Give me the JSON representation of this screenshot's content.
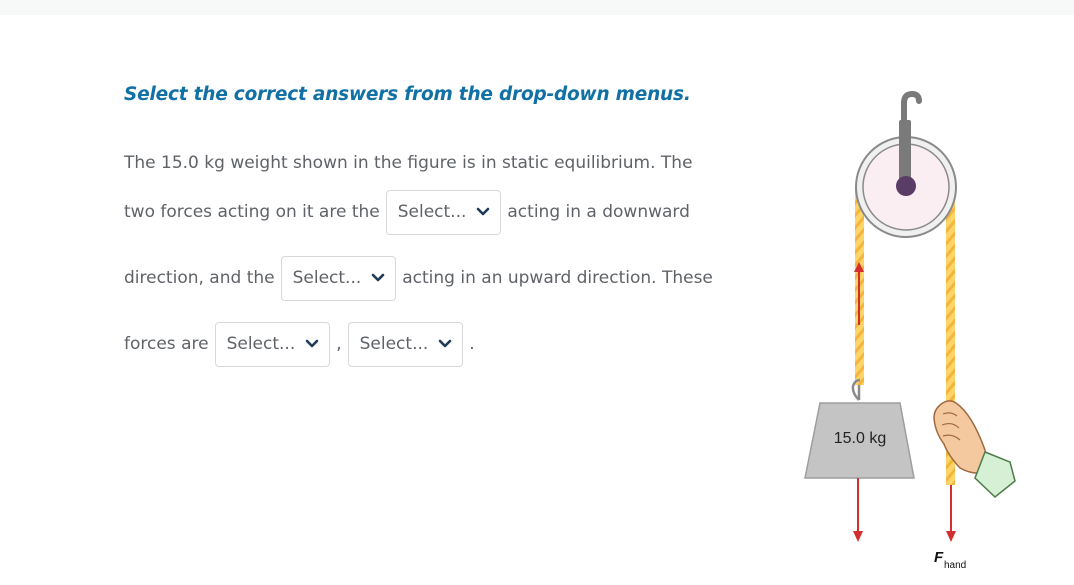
{
  "instruction": "Select the correct answers from the drop-down menus.",
  "question": {
    "line1": "The 15.0 kg weight shown in the figure is in static equilibrium. The",
    "line2_before": "two forces acting on it are the",
    "line2_after": "acting in a downward",
    "line3_before": "direction, and the",
    "line3_after": "acting in an upward direction. These",
    "line4_before": "forces are",
    "line4_sep": ",",
    "line4_end": "."
  },
  "dropdowns": [
    {
      "selected": "Select..."
    },
    {
      "selected": "Select..."
    },
    {
      "selected": "Select..."
    },
    {
      "selected": "Select..."
    }
  ],
  "figure": {
    "weight_label": "15.0 kg",
    "force_label_main": "F",
    "force_label_sub": "hand"
  },
  "colors": {
    "instruction": "#1170a4",
    "text": "#5f6368",
    "rope": "#f9c74f",
    "arrow": "#d32f2f",
    "weight": "#c4c4c4",
    "pulley": "#fbeef2"
  },
  "icons": [
    "chevron-down-icon"
  ]
}
